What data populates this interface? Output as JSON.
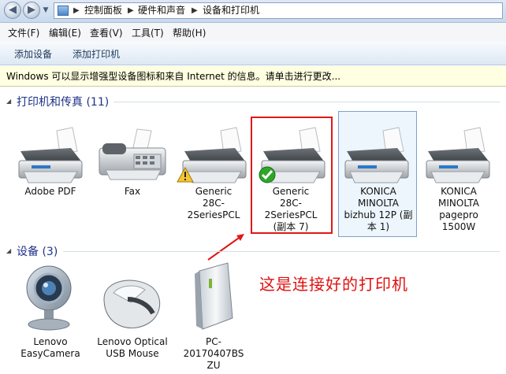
{
  "address_bar": {
    "breadcrumbs": [
      "控制面板",
      "硬件和声音",
      "设备和打印机"
    ]
  },
  "menu": [
    "文件(F)",
    "编辑(E)",
    "查看(V)",
    "工具(T)",
    "帮助(H)"
  ],
  "commands": {
    "add_device": "添加设备",
    "add_printer": "添加打印机"
  },
  "infobar": {
    "text": "Windows 可以显示增强型设备图标和来自 Internet 的信息。请单击进行更改..."
  },
  "printers_group": {
    "label": "打印机和传真 (11)",
    "items": [
      {
        "label": "Adobe PDF",
        "icon": "printer-icon"
      },
      {
        "label": "Fax",
        "icon": "fax-icon"
      },
      {
        "label": "Generic\n28C-2SeriesPCL",
        "icon": "printer-icon",
        "badge": "warning-icon"
      },
      {
        "label": "Generic\n28C-2SeriesPCL\n(副本 7)",
        "icon": "printer-icon",
        "badge": "default-check-icon"
      },
      {
        "label": "KONICA\nMINOLTA\nbizhub 12P (副\n本 1)",
        "icon": "printer-icon"
      },
      {
        "label": "KONICA\nMINOLTA\npagepro\n1500W",
        "icon": "printer-icon"
      }
    ]
  },
  "devices_group": {
    "label": "设备 (3)",
    "items": [
      {
        "label": "Lenovo\nEasyCamera",
        "icon": "webcam-icon"
      },
      {
        "label": "Lenovo Optical\nUSB Mouse",
        "icon": "mouse-icon"
      },
      {
        "label": "PC-20170407BS\nZU",
        "icon": "computer-tower-icon"
      }
    ]
  },
  "annotation": {
    "text": "这是连接好的打印机",
    "color": "#e01010"
  }
}
